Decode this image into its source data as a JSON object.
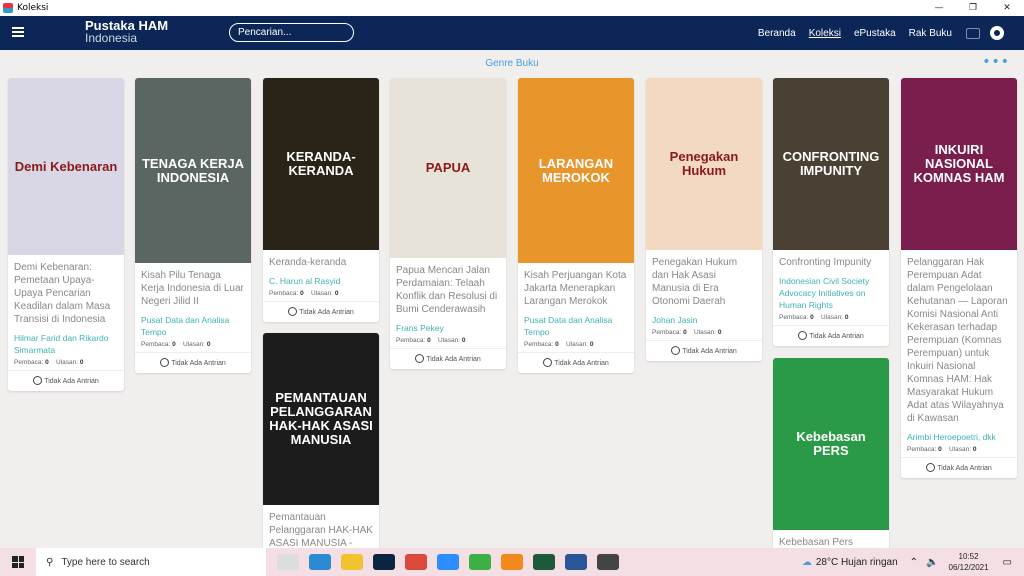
{
  "window": {
    "title": "Koleksi"
  },
  "nav": {
    "brand_line1": "Pustaka HAM",
    "brand_line2": "Indonesia",
    "search_placeholder": "Pencarian...",
    "links": [
      "Beranda",
      "Koleksi",
      "ePustaka",
      "Rak Buku"
    ],
    "active": "Koleksi"
  },
  "section": {
    "title": "Genre Buku",
    "more": "•••"
  },
  "labels": {
    "readers": "Pembaca:",
    "reviews": "Ulasan:",
    "queue": "Tidak Ada Antrian"
  },
  "books": [
    {
      "title": "Demi Kebenaran: Pemetaan Upaya-Upaya Pencarian Keadilan dalam Masa Transisi di Indonesia",
      "author": "Hilmar Farid dan Rikardo Simarmata",
      "readers": "0",
      "reviews": "0",
      "cover_text": "Demi Kebenaran",
      "cover_color": "#d9d6e6"
    },
    {
      "title": "Kisah Pilu Tenaga Kerja Indonesia di Luar Negeri Jilid II",
      "author": "Pusat Data dan Analisa Tempo",
      "readers": "0",
      "reviews": "0",
      "cover_text": "TENAGA KERJA INDONESIA",
      "cover_color": "#5b6662"
    },
    {
      "title": "Keranda-keranda",
      "author": "C. Harun al Rasyid",
      "readers": "0",
      "reviews": "0",
      "cover_text": "KERANDA-KERANDA",
      "cover_color": "#2a2418"
    },
    {
      "title": "Pemantauan Pelanggaran HAK-HAK ASASI MANUSIA -",
      "author": "",
      "readers": "",
      "reviews": "",
      "cover_text": "PEMANTAUAN PELANGGARAN HAK-HAK ASASI MANUSIA",
      "cover_color": "#1c1c1c"
    },
    {
      "title": "Papua Mencari Jalan Perdamaian: Telaah Konflik dan Resolusi di Bumi Cenderawasih",
      "author": "Frans Pekey",
      "readers": "0",
      "reviews": "0",
      "cover_text": "PAPUA",
      "cover_color": "#e8e3d8"
    },
    {
      "title": "Kisah Perjuangan Kota Jakarta Menerapkan Larangan Merokok",
      "author": "Pusat Data dan Analisa Tempo",
      "readers": "0",
      "reviews": "0",
      "cover_text": "LARANGAN MEROKOK",
      "cover_color": "#e8962c"
    },
    {
      "title": "Penegakan Hukum dan Hak Asasi Manusia di Era Otonomi Daerah",
      "author": "Johan Jasin",
      "readers": "0",
      "reviews": "0",
      "cover_text": "Penegakan Hukum",
      "cover_color": "#f3d9c2"
    },
    {
      "title": "Confronting Impunity",
      "author": "Indonesian Civil Society Advocacy Initiatives on Human Rights",
      "readers": "0",
      "reviews": "0",
      "cover_text": "CONFRONTING IMPUNITY",
      "cover_color": "#4b4034"
    },
    {
      "title": "Kebebasan Pers",
      "author": "",
      "readers": "",
      "reviews": "",
      "cover_text": "Kebebasan PERS",
      "cover_color": "#2a9a48"
    },
    {
      "title": "Pelanggaran Hak Perempuan Adat dalam Pengelolaan Kehutanan — Laporan Komisi Nasional Anti Kekerasan terhadap Perempuan (Komnas Perempuan) untuk Inkuiri Nasional Komnas HAM: Hak Masyarakat Hukum Adat atas Wilayahnya di Kawasan",
      "author": "Arimbi Heroepoetri, dkk",
      "readers": "0",
      "reviews": "0",
      "cover_text": "INKUIRI NASIONAL KOMNAS HAM",
      "cover_color": "#7a1e4e"
    }
  ],
  "taskbar": {
    "search_placeholder": "Type here to search",
    "weather": "28°C  Hujan ringan",
    "time": "10:52",
    "date": "06/12/2021"
  }
}
